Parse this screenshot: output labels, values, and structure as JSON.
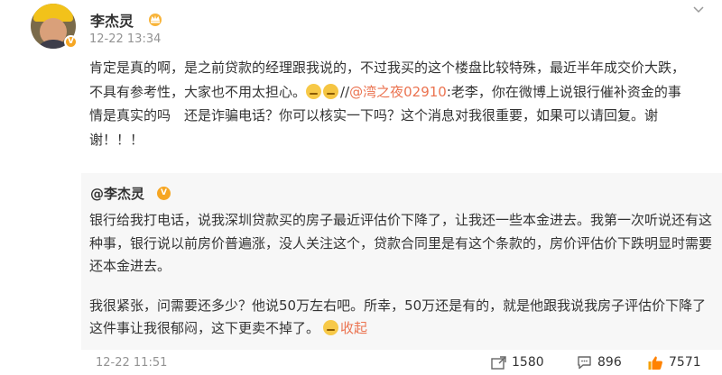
{
  "post": {
    "username": "李杰灵",
    "time": "12-22 13:34",
    "text_part1": "肯定是真的啊，是之前贷款的经理跟我说的，不过我买的这个楼盘比较特殊，最近半年成交价大跌，不具有参考性，大家也不用太担心。",
    "text_sep": "//",
    "mention": "@湾之夜02910",
    "text_part2": ":老李，你在微博上说银行催补资金的事情是真实的吗　还是诈骗电话？你可以核实一下吗？这个消息对我很重要，如果可以请回复。谢谢！！！"
  },
  "repost": {
    "author": "@李杰灵",
    "paragraph1": "银行给我打电话，说我深圳贷款买的房子最近评估价下降了，让我还一些本金进去。我第一次听说还有这种事，银行说以前房价普遍涨，没人关注这个，贷款合同里是有这个条款的，房价评估价下跌明显时需要还本金进去。",
    "paragraph2": "我很紧张，问需要还多少？他说50万左右吧。所幸，50万还是有的，就是他跟我说我房子评估价下降了这件事让我很郁闷，这下更卖不掉了。",
    "collapse_label": "收起"
  },
  "footer": {
    "time": "12-22 11:51",
    "reposts": "1580",
    "comments": "896",
    "likes": "7571"
  },
  "colors": {
    "link": "#eb7350",
    "muted": "#939393",
    "repost_bg": "#f7f7f7",
    "verified_badge": "#f6a623"
  },
  "icons": [
    "crown-icon",
    "more-chevron-icon",
    "repost-icon",
    "comment-icon",
    "like-icon",
    "verified-badge-icon"
  ]
}
